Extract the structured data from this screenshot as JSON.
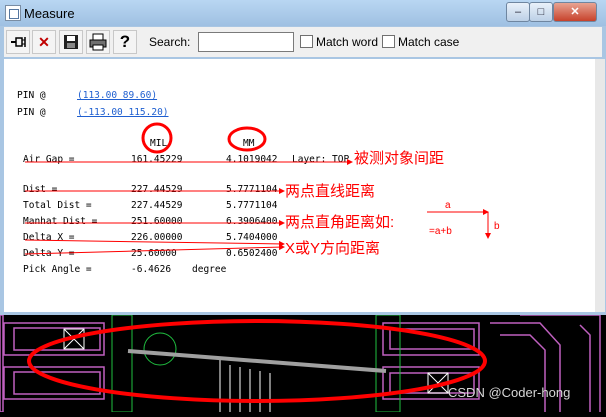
{
  "window": {
    "title": "Measure"
  },
  "titlebar_buttons": {
    "minimize": "–",
    "maximize": "□",
    "close": "✕"
  },
  "toolbar": {
    "icons": [
      "pin-icon",
      "close-x-icon",
      "save-icon",
      "print-icon",
      "help-icon"
    ],
    "search_label": "Search:",
    "search_value": "",
    "match_word_label": "Match word",
    "match_case_label": "Match case"
  },
  "report": {
    "pins": [
      {
        "label": "PIN @",
        "coords": "(113.00 89.60)"
      },
      {
        "label": "PIN @",
        "coords": "(-113.00 115.20)"
      }
    ],
    "col_mil": "MIL",
    "col_mm": "MM",
    "rows": [
      {
        "label": "Air Gap =",
        "mil": "161.45229",
        "mm": "4.1019042",
        "extra": "Layer: TOP"
      },
      {
        "label": "Dist =",
        "mil": "227.44529",
        "mm": "5.7771104",
        "extra": ""
      },
      {
        "label": "Total Dist =",
        "mil": "227.44529",
        "mm": "5.7771104",
        "extra": ""
      },
      {
        "label": "Manhat Dist =",
        "mil": "251.60000",
        "mm": "6.3906400",
        "extra": ""
      },
      {
        "label": "Delta X =",
        "mil": "226.00000",
        "mm": "5.7404000",
        "extra": ""
      },
      {
        "label": "Delta Y =",
        "mil": "25.60000",
        "mm": "0.6502400",
        "extra": ""
      },
      {
        "label": "Pick Angle =",
        "mil": "-6.4626",
        "mm": "degree",
        "extra": ""
      }
    ]
  },
  "annotations": {
    "air_gap": "被测对象间距",
    "dist": "两点直线距离",
    "manhat": "两点直角距离如:",
    "delta": "X或Y方向距离",
    "diagram_a": "a",
    "diagram_b": "b",
    "diagram_formula": "=a+b"
  },
  "watermark": "CSDN @Coder-hong",
  "colors": {
    "annotation": "#ff0000",
    "pcb_outline": "#c060c0",
    "pcb_trace": "#a0a0a0",
    "pcb_green": "#20c040"
  }
}
